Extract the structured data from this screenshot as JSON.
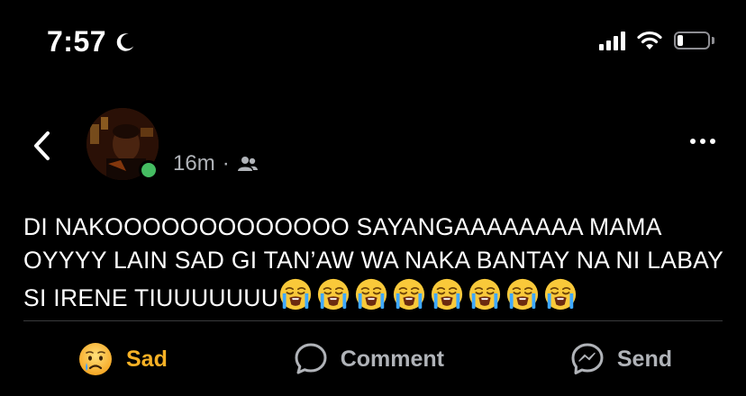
{
  "status_bar": {
    "time": "7:57",
    "moon_icon": "moon-icon",
    "signal_icon": "cellular-signal-icon",
    "wifi_icon": "wifi-icon",
    "battery_icon": "battery-icon",
    "battery_level": 0.2
  },
  "header": {
    "back_icon": "chevron-left-icon",
    "timestamp": "16m",
    "separator": "·",
    "audience_icon": "friends-icon",
    "more_icon": "more-dots-icon"
  },
  "post": {
    "text": "DI NAKOOOOOOOOOOOOO SAYANGAAAAAAAA MAMA OYYYY LAIN SAD GI TAN’AW WA NAKA BANTAY NA NI LABAY SI IRENE TIUUUUUUU",
    "emoji_count": 8,
    "emoji_icon": "loudly-crying-face-emoji"
  },
  "actions": {
    "reaction_label": "Sad",
    "reaction_icon": "sad-face-icon",
    "comment_label": "Comment",
    "comment_icon": "comment-bubble-icon",
    "send_label": "Send",
    "send_icon": "messenger-icon"
  },
  "colors": {
    "background": "#000000",
    "text": "#ffffff",
    "muted": "#b0b3b8",
    "online": "#45bd62",
    "sad_reaction": "#f7b125",
    "divider": "#3a3b3c"
  }
}
